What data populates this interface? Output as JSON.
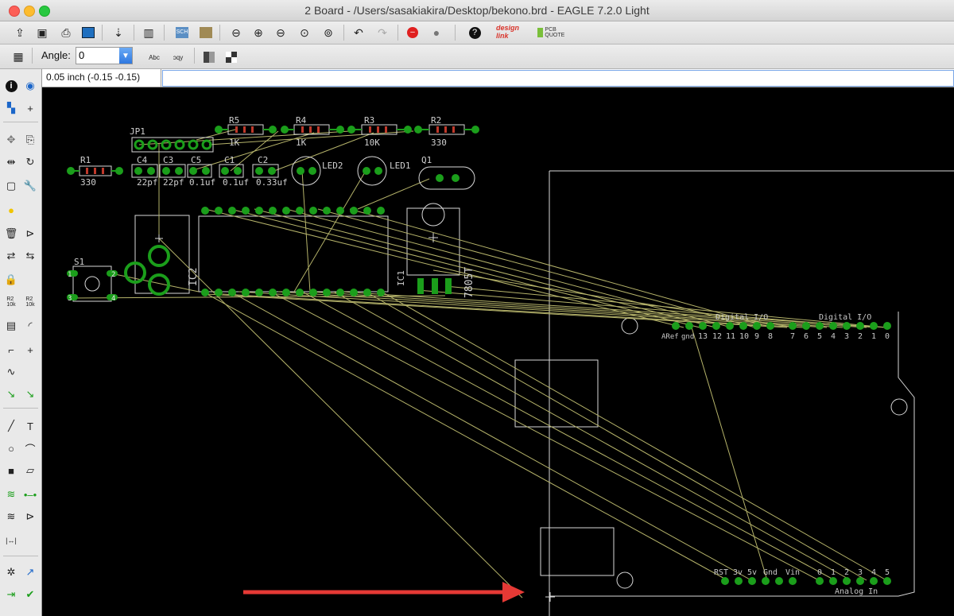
{
  "window": {
    "title": "2 Board - /Users/sasakiakira/Desktop/bekono.brd - EAGLE 7.2.0 Light"
  },
  "param_bar": {
    "angle_label": "Angle:",
    "angle_value": "0"
  },
  "coord_bar": {
    "readout": "0.05 inch (-0.15 -0.15)"
  },
  "toolbar": {
    "icons": [
      "open-icon",
      "save-icon",
      "print-icon",
      "cam-icon",
      "script-icon",
      "ulp-icon",
      "schematic-icon",
      "board-icon",
      "zoom-fit-icon",
      "zoom-in-icon",
      "zoom-out-icon",
      "zoom-redraw-icon",
      "zoom-select-icon",
      "undo-icon",
      "redo-icon",
      "stop-icon",
      "go-icon",
      "help-icon",
      "design-link-icon",
      "pcb-quote-icon"
    ],
    "design_link": "design link",
    "pcb_quote": "PCB QUOTE"
  },
  "board": {
    "components": {
      "R1": {
        "name": "R1",
        "value": "330"
      },
      "R2": {
        "name": "R2",
        "value": "330"
      },
      "R3": {
        "name": "R3",
        "value": "10K"
      },
      "R4": {
        "name": "R4",
        "value": "1K"
      },
      "R5": {
        "name": "R5",
        "value": "1K"
      },
      "JP1": {
        "name": "JP1"
      },
      "C4": {
        "name": "C4",
        "value": "22pf"
      },
      "C3": {
        "name": "C3",
        "value": "22pf"
      },
      "C5": {
        "name": "C5",
        "value": "0.1uf"
      },
      "C1": {
        "name": "C1",
        "value": "0.1uf"
      },
      "C2": {
        "name": "C2",
        "value": "0.33uf"
      },
      "LED2": {
        "name": "LED2"
      },
      "LED1": {
        "name": "LED1"
      },
      "Q1": {
        "name": "Q1"
      },
      "IC2": {
        "name": "IC2"
      },
      "IC1": {
        "name": "IC1",
        "value": "7805T"
      },
      "S1": {
        "name": "S1"
      }
    },
    "s1_pins": [
      "1",
      "2",
      "3",
      "4"
    ],
    "arduino": {
      "digital_label_1": "Digital I/O",
      "digital_label_2": "Digital I/O",
      "aref_label": "ARef",
      "gnd_label": "gnd",
      "digital_pins": [
        "13",
        "12",
        "11",
        "10",
        "9",
        "8",
        "7",
        "6",
        "5",
        "4",
        "3",
        "2",
        "1",
        "0"
      ],
      "power_pins": [
        "RST",
        "3v",
        "5v",
        "Gnd",
        "Vin"
      ],
      "analog_pins": [
        "0",
        "1",
        "2",
        "3",
        "4",
        "5"
      ],
      "analog_label": "Analog In"
    }
  },
  "colors": {
    "canvas_bg": "#000000",
    "pad": "#1b9e1b",
    "airwire": "#b5b36a",
    "outline": "#d8d8d8",
    "annotation_arrow": "#e53935"
  }
}
